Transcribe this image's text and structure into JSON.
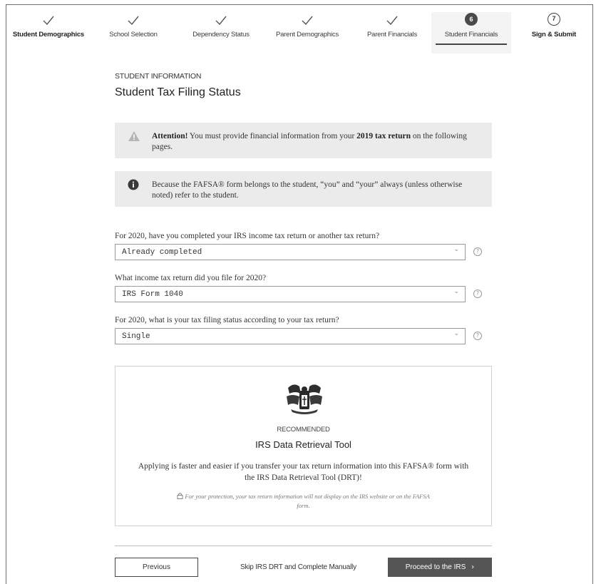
{
  "stepper": {
    "steps": [
      {
        "label": "Student Demographics",
        "state": "complete"
      },
      {
        "label": "School Selection",
        "state": "complete"
      },
      {
        "label": "Dependency Status",
        "state": "complete"
      },
      {
        "label": "Parent Demographics",
        "state": "complete"
      },
      {
        "label": "Parent Financials",
        "state": "complete"
      },
      {
        "label": "Student Financials",
        "state": "current",
        "number": "6"
      },
      {
        "label": "Sign & Submit",
        "state": "upcoming",
        "number": "7"
      }
    ]
  },
  "header": {
    "section_label": "STUDENT INFORMATION",
    "title": "Student Tax Filing Status"
  },
  "attention": {
    "lead": "Attention!",
    "text_before": " You must provide financial information from your ",
    "emphasis": "2019 tax return",
    "text_after": " on the following pages.",
    "icon": "warning-triangle-icon"
  },
  "notice": {
    "text": "Because the FAFSA® form belongs to the student, “you” and “your” always (unless otherwise noted) refer to the student.",
    "icon": "info-circle-icon"
  },
  "questions": [
    {
      "label": "For 2020, have you completed your IRS income tax return or another tax return?",
      "value": "Already completed"
    },
    {
      "label": "What income tax return did you file for 2020?",
      "value": "IRS Form 1040"
    },
    {
      "label": "For 2020, what is your tax filing status according to your tax return?",
      "value": "Single"
    }
  ],
  "drt": {
    "recommended": "RECOMMENDED",
    "title": "IRS Data Retrieval Tool",
    "description": "Applying is faster and easier if you transfer your tax return information into this FAFSA® form with the IRS Data Retrieval Tool (DRT)!",
    "note": "For your protection, your tax return information will not display on the IRS website or on the FAFSA form.",
    "logo_icon": "irs-eagle-logo"
  },
  "footer": {
    "previous": "Previous",
    "skip": "Skip IRS DRT and Complete Manually",
    "proceed": "Proceed to the IRS",
    "proceed_arrow": "›"
  }
}
